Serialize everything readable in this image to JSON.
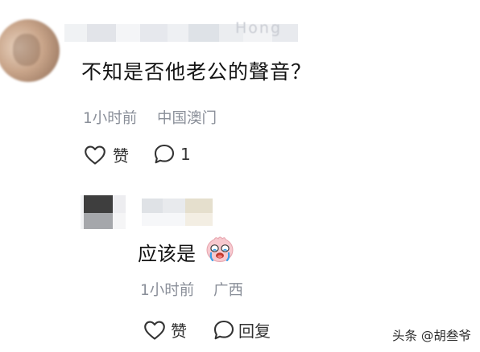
{
  "comment": {
    "text": "不知是否他老公的聲音？",
    "time": "1小时前",
    "location": "中国澳门",
    "like_label": "赞",
    "reply_count": "1",
    "like_icon": "heart-outline-icon",
    "comment_icon": "chat-bubble-icon"
  },
  "reply": {
    "text": "应该是",
    "emoji": "crying-face-emoji",
    "time": "1小时前",
    "location": "广西",
    "like_label": "赞",
    "reply_label": "回复"
  },
  "watermark": {
    "text": "头条 @胡叁爷"
  },
  "colors": {
    "text": "#141414",
    "meta": "#8a8f99",
    "icon": "#333333",
    "background": "#ffffff"
  }
}
